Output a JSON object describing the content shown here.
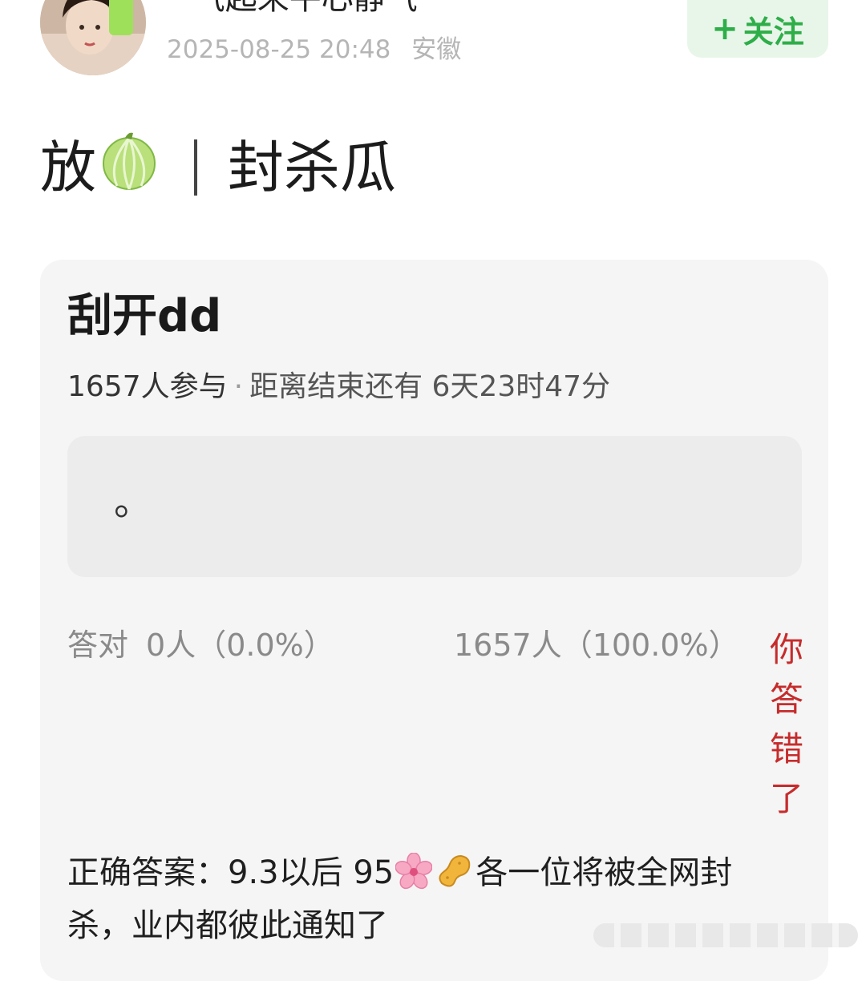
{
  "header": {
    "username": "“气起来平心静气”",
    "time": "2025-08-25 20:48",
    "location": "安徽",
    "follow_label": "关注"
  },
  "post": {
    "word_1": "放",
    "word_2": "封杀瓜"
  },
  "quiz": {
    "title": "刮开dd",
    "participants": "1657人参与",
    "deadline": "距离结束还有 6天23时47分",
    "option_text": "。",
    "correct_label": "答对",
    "correct_count": "0人（0.0%）",
    "wrong_count": "1657人（100.0%）",
    "wrong_note": "你答错了",
    "answer_line": "正确答案：9.3以后 95",
    "answer_rest": "各一位将被全网封杀，业内都彼此通知了"
  },
  "colors": {
    "follow_green": "#2eae48",
    "follow_bg": "#e8f6ea",
    "wrong_red": "#c62c2c",
    "card_bg": "#f5f5f5"
  },
  "icons": {
    "melon": "melon-icon",
    "flower": "cherry-blossom-icon",
    "peanut": "peanut-icon"
  }
}
